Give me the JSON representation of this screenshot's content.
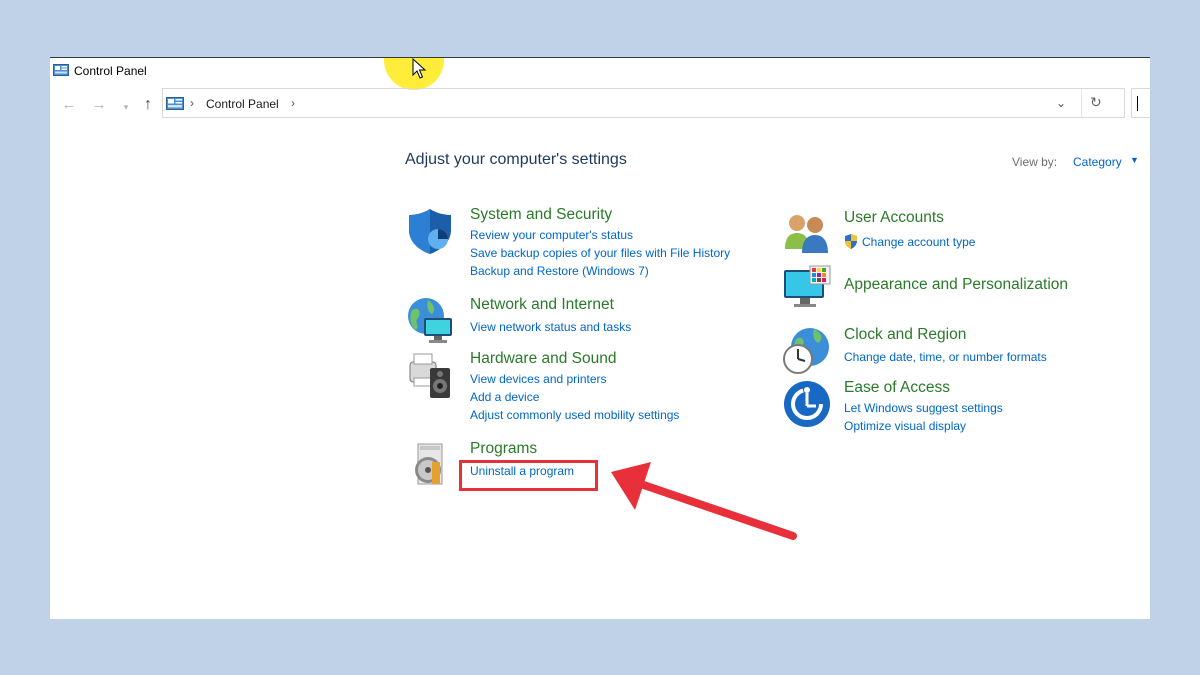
{
  "window": {
    "title": "Control Panel"
  },
  "address": {
    "breadcrumb": "Control Panel"
  },
  "main": {
    "heading": "Adjust your computer's settings",
    "view_by_label": "View by:",
    "view_by_value": "Category"
  },
  "categories": {
    "system": {
      "title": "System and Security",
      "links": [
        "Review your computer's status",
        "Save backup copies of your files with File History",
        "Backup and Restore (Windows 7)"
      ]
    },
    "network": {
      "title": "Network and Internet",
      "links": [
        "View network status and tasks"
      ]
    },
    "hardware": {
      "title": "Hardware and Sound",
      "links": [
        "View devices and printers",
        "Add a device",
        "Adjust commonly used mobility settings"
      ]
    },
    "programs": {
      "title": "Programs",
      "links": [
        "Uninstall a program"
      ]
    },
    "accounts": {
      "title": "User Accounts",
      "links": [
        "Change account type"
      ]
    },
    "appearance": {
      "title": "Appearance and Personalization",
      "links": []
    },
    "clock": {
      "title": "Clock and Region",
      "links": [
        "Change date, time, or number formats"
      ]
    },
    "ease": {
      "title": "Ease of Access",
      "links": [
        "Let Windows suggest settings",
        "Optimize visual display"
      ]
    }
  },
  "icons": {
    "title": "control-panel-icon",
    "back": "back-arrow-icon",
    "forward": "forward-arrow-icon",
    "recent": "recent-locations-icon",
    "up": "up-arrow-icon",
    "refresh": "refresh-icon",
    "dropdown": "chevron-down-icon"
  },
  "colors": {
    "page_background": "#c0d2e8",
    "link": "#0066cc",
    "category_title": "#2a7a2a",
    "heading": "#1e395b",
    "highlight_box": "#e8303a",
    "cursor_highlight": "#ffec28"
  }
}
